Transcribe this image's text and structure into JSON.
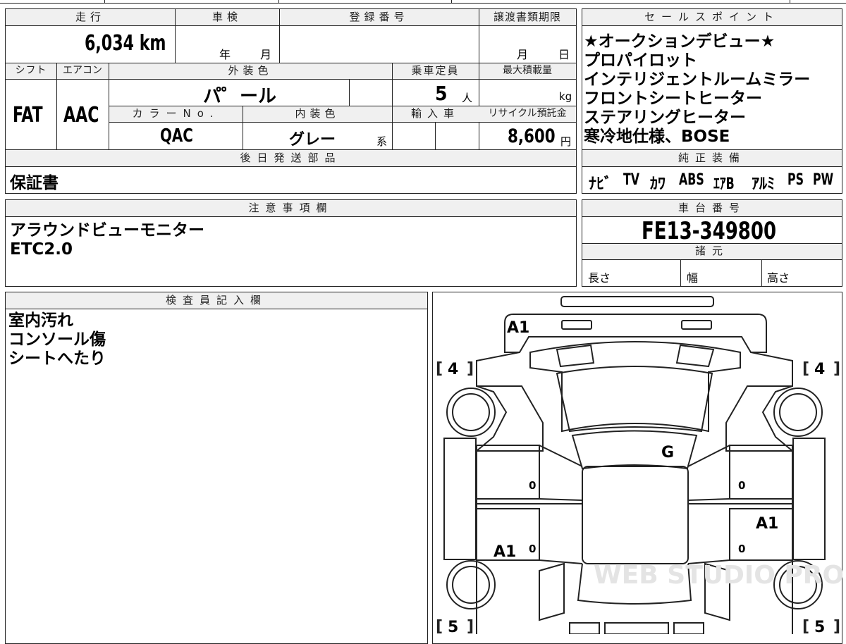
{
  "top_sheet": {
    "mileage": {
      "header": "走行",
      "value": "6,034 km"
    },
    "shaken": {
      "header": "車検",
      "year_unit": "年",
      "month_unit": "月"
    },
    "registration": {
      "header": "登録番号"
    },
    "transfer_deadline": {
      "header": "譲渡書類期限",
      "month_unit": "月",
      "day_unit": "日"
    },
    "shift": {
      "header": "シフト",
      "value": "FAT"
    },
    "aircon": {
      "header": "エアコン",
      "value": "AAC"
    },
    "exterior_color": {
      "header": "外装色",
      "value": "パ゜ール"
    },
    "capacity": {
      "header": "乗車定員",
      "value": "5",
      "unit": "人"
    },
    "max_load": {
      "header": "最大積載量",
      "unit": "kg"
    },
    "color_no": {
      "header": "カラーNo.",
      "value": "QAC"
    },
    "interior_color": {
      "header": "内装色",
      "value": "グレー",
      "suffix": "系"
    },
    "import": {
      "header": "輸入車"
    },
    "recycle": {
      "header": "リサイクル預託金",
      "value": "8,600",
      "unit": "円"
    },
    "later_parts": {
      "header": "後日発送部品",
      "value": "保証書"
    }
  },
  "sales_points": {
    "header": "セールスポイント",
    "lines": [
      "★オークションデビュー★",
      "プロパイロット",
      "インテリジェントルームミラー",
      "フロントシートヒーター",
      "ステアリングヒーター",
      "寒冷地仕様、BOSE"
    ]
  },
  "genuine_equipment": {
    "header": "純正装備",
    "items": [
      "ﾅﾋﾞ",
      "TV",
      "ｶﾜ",
      "ABS",
      "ｴｱB",
      "ｱﾙﾐ",
      "PS",
      "PW"
    ]
  },
  "notes": {
    "header": "注意事項欄",
    "lines": [
      "アラウンドビューモニター",
      "ETC2.0"
    ]
  },
  "chassis": {
    "header": "車台番号",
    "value": "FE13-349800",
    "specs_header": "諸元",
    "length_label": "長さ",
    "width_label": "幅",
    "height_label": "高さ"
  },
  "inspector": {
    "header": "検査員記入欄",
    "lines": [
      "室内汚れ",
      "コンソール傷",
      "シートへたり"
    ]
  },
  "diagram": {
    "marks": {
      "front": "A1",
      "windshield": "G",
      "right_rear_door": "A1",
      "left_rear_door": "A1"
    },
    "tire_front_left": "4",
    "tire_front_right": "4",
    "tire_rear_left": "5",
    "tire_rear_right": "5",
    "door_left_front": "0",
    "door_left_rear": "0",
    "door_right_front": "0",
    "door_right_rear": "0",
    "watermark": "WEB STUDIO PRO"
  },
  "colors": {
    "line": "#222222",
    "header_bg": "#f0f0f0"
  }
}
